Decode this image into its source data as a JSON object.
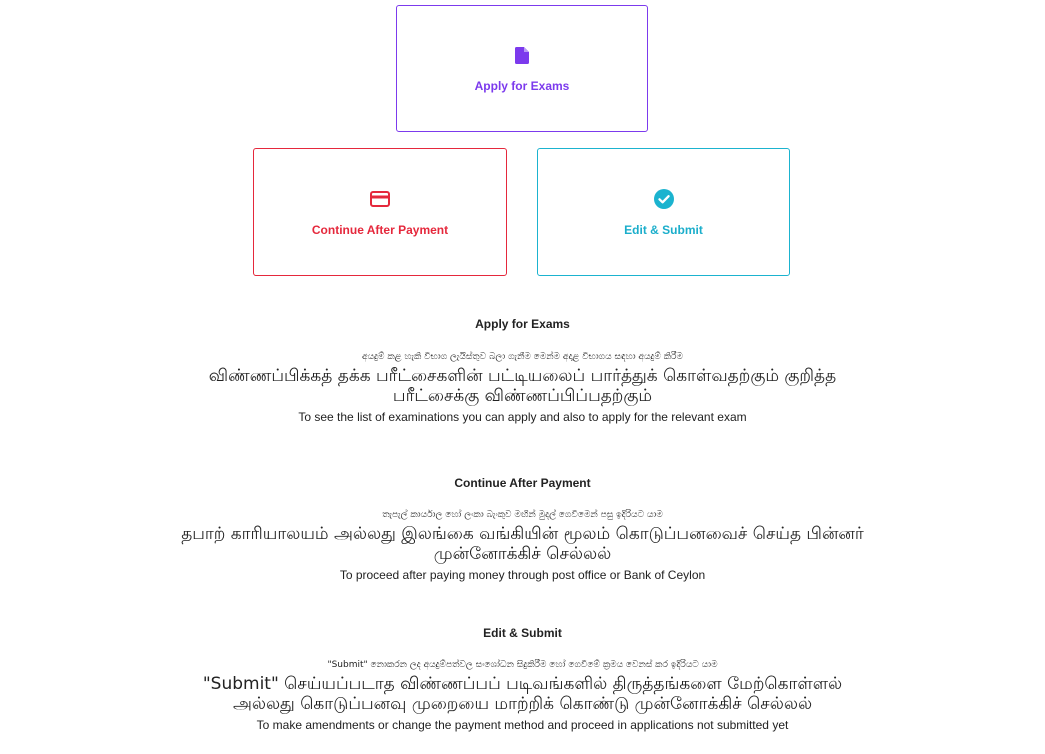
{
  "cards": {
    "apply": {
      "label": "Apply for Exams",
      "color": "#7c3aed",
      "icon": "file-icon"
    },
    "payment": {
      "label": "Continue After Payment",
      "color": "#e5283c",
      "icon": "credit-card-icon"
    },
    "edit": {
      "label": "Edit & Submit",
      "color": "#1bb3cf",
      "icon": "check-circle-icon"
    }
  },
  "sections": [
    {
      "heading": "Apply for Exams",
      "sinhala": "අයදුම් කළ හැකි විභාග ලැයිස්තුව බලා ගැනීම මෙන්ම අදාළ විභාගය සඳහා අයදුම් කිරීම",
      "tamil": "விண்ணப்பிக்கத் தக்க பரீட்சைகளின் பட்டியலைப் பார்த்துக் கொள்வதற்கும் குறித்த பரீட்சைக்கு விண்ணப்பிப்பதற்கும்",
      "english": "To see the list of examinations you can apply and also to apply for the relevant exam"
    },
    {
      "heading": "Continue After Payment",
      "sinhala": "තැපැල් කාර්යාල හෝ ලංකා බැංකුව මඟින් මුදල් ගෙවීමෙන් පසු ඉදිරියට යාම",
      "tamil": "தபாற் காரியாலயம் அல்லது இலங்கை வங்கியின் மூலம் கொடுப்பனவைச் செய்த பின்னர் முன்னோக்கிச் செல்லல்",
      "english": "To proceed after paying money through post office or Bank of Ceylon"
    },
    {
      "heading": "Edit & Submit",
      "sinhala": "\"Submit\" නොකරන ලද අයදුම්පත්වල සංශෝධන සිදුකිරීම හෝ ගෙවීමේ ක්‍රමය වෙනස් කර ඉදිරියට යාම",
      "tamil": "\"Submit\" செய்யப்படாத விண்ணப்பப் படிவங்களில் திருத்தங்களை மேற்கொள்ளல் அல்லது கொடுப்பனவு முறையை மாற்றிக் கொண்டு முன்னோக்கிச் செல்லல்",
      "english": "To make amendments or change the payment method and proceed in applications not submitted yet"
    }
  ]
}
